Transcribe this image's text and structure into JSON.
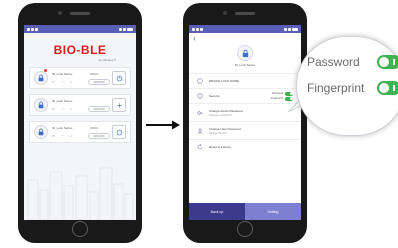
{
  "left_phone": {
    "brand": "BIO-BLE",
    "brand_sub": "by Ultraloq ®",
    "cards": [
      {
        "name": "ID_Lock Series",
        "value": "00001",
        "pill": "000:000"
      },
      {
        "name": "ID_Lock Series",
        "value": "",
        "pill": "000:000"
      },
      {
        "name": "ID_Lock Series",
        "value": "00001",
        "pill": "000:000"
      }
    ]
  },
  "right_phone": {
    "device_name": "ID_Lock Series",
    "menu": [
      {
        "title": "DEVICE LOCK NAME",
        "subtitle": ""
      },
      {
        "title": "Security",
        "subtitle": ""
      },
      {
        "title": "Change Admin Password",
        "subtitle": "Change to 1000 PIN"
      },
      {
        "title": "Change User Password",
        "subtitle": "Change the PIN"
      },
      {
        "title": "Reset to Factory",
        "subtitle": ""
      }
    ],
    "security_options": [
      "Password",
      "Fingerprint"
    ],
    "bottom_buttons": [
      "Back up",
      "Setting"
    ]
  },
  "callout": {
    "options": [
      "Password",
      "Fingerprint"
    ],
    "toggle_color": "#3fb34f"
  },
  "colors": {
    "status_bar": "#5b5eb7",
    "brand_red": "#e11b1b",
    "bottom_dark": "#3c3a8c",
    "bottom_light": "#7f7fd1"
  }
}
